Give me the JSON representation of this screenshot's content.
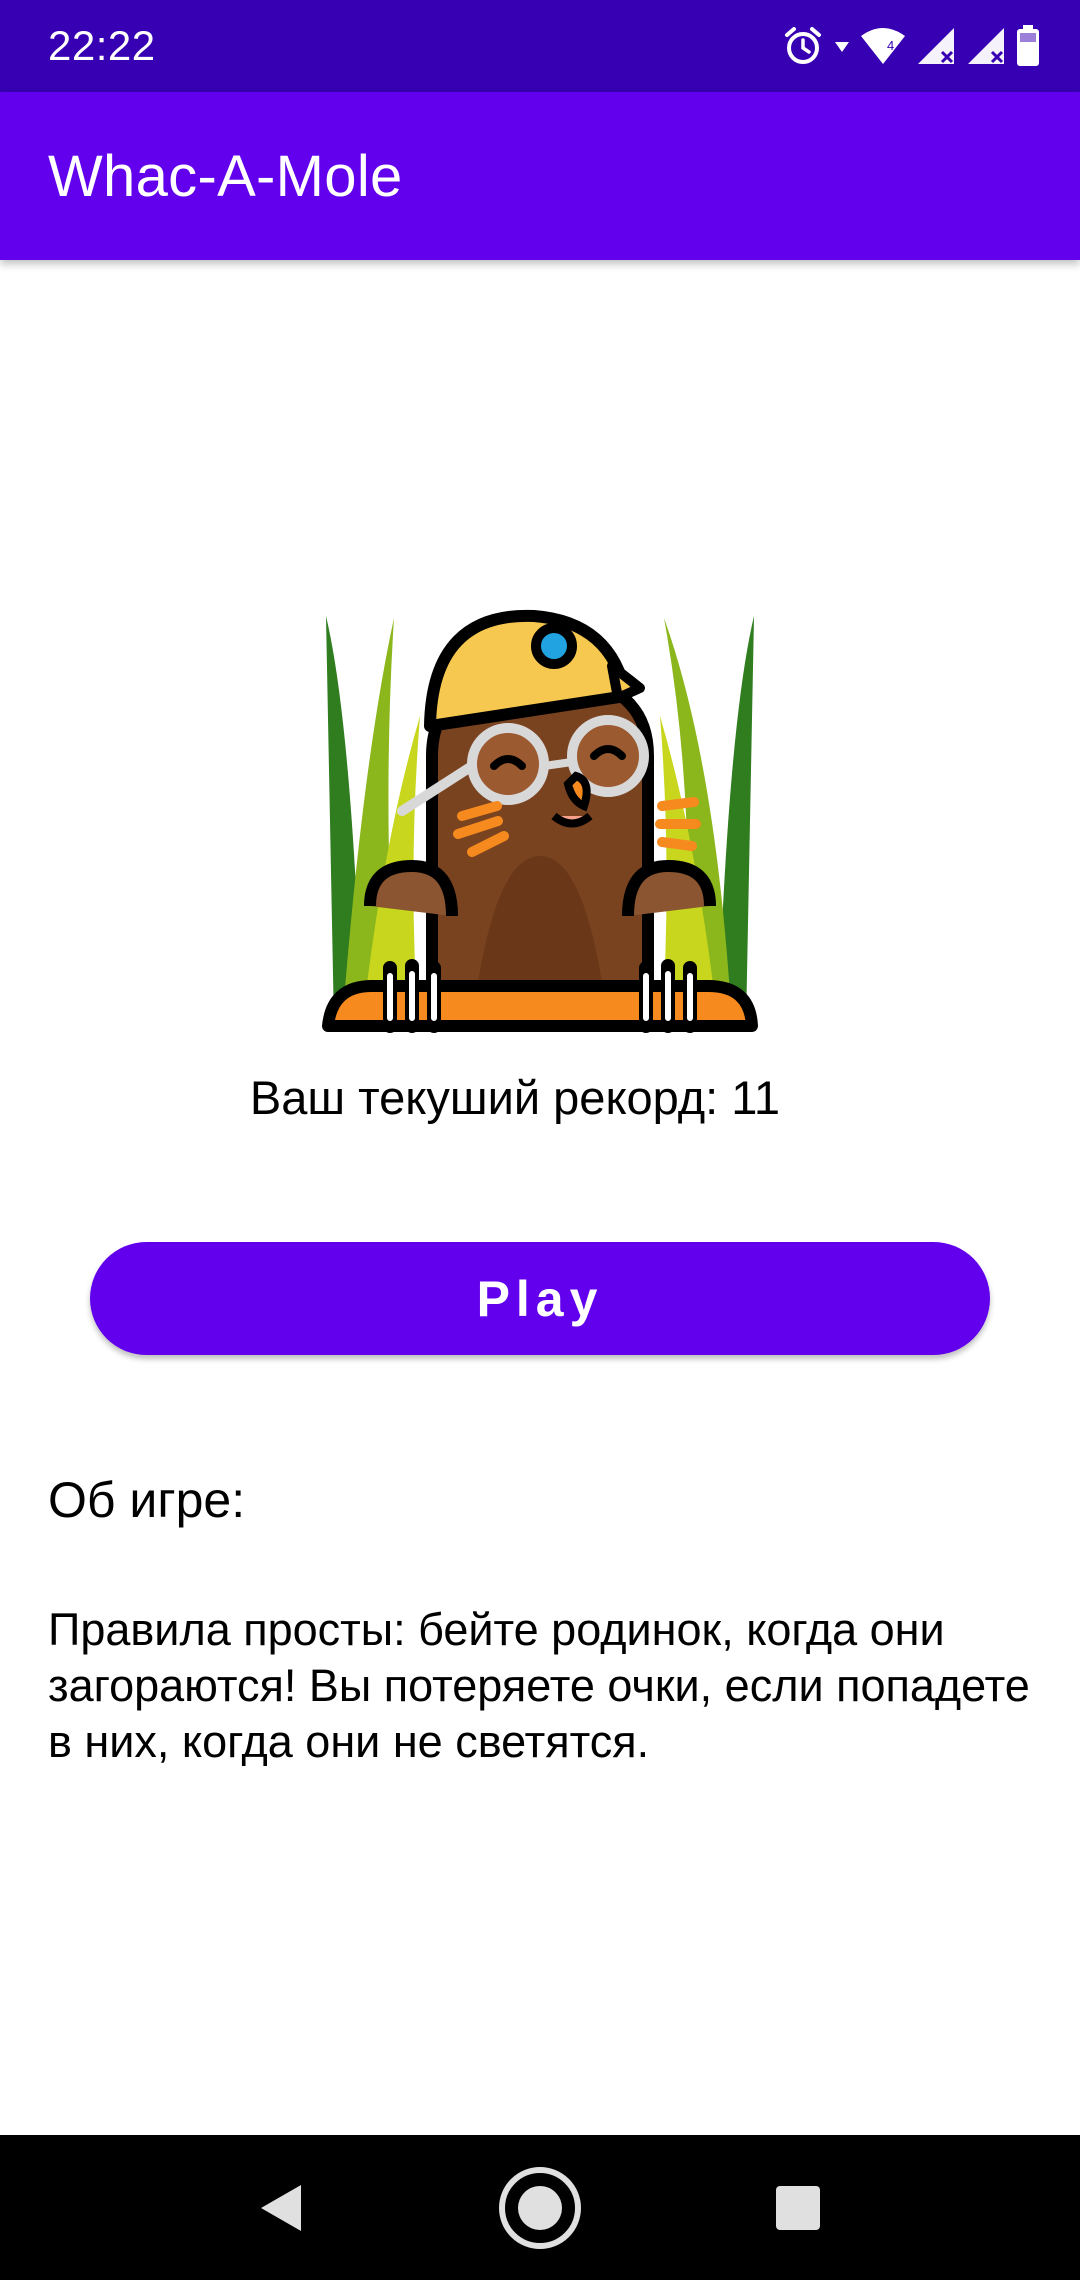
{
  "status_bar": {
    "time": "22:22",
    "icons": [
      "alarm-icon",
      "wifi-icon",
      "signal-icon",
      "signal-icon",
      "battery-icon"
    ],
    "network_label": "4"
  },
  "app_bar": {
    "title": "Whac-A-Mole"
  },
  "main": {
    "illustration": "mole-with-helmet-illustration",
    "record_text": "Ваш текуший рекорд: 11",
    "play_label": "Play",
    "about_heading": "Об игре:",
    "about_body": "Правила просты: бейте родинок, когда они загораются! Вы потеряете очки, если попадете в них, когда они не светятся."
  },
  "nav_bar": {
    "buttons": [
      "back-icon",
      "home-icon",
      "recents-icon"
    ]
  },
  "colors": {
    "status_bar": "#3700b3",
    "app_bar": "#6200ee",
    "button": "#6200ee",
    "nav_bar": "#000000"
  }
}
